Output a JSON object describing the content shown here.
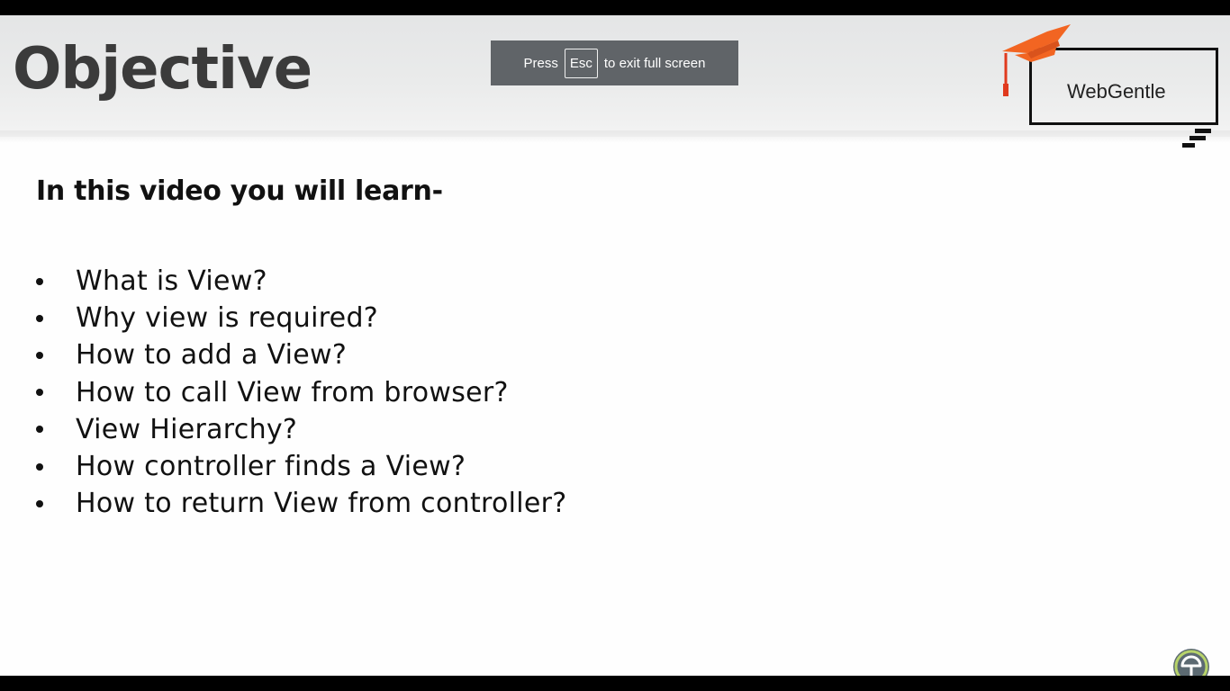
{
  "slide": {
    "title": "Objective",
    "subtitle": "In this video you will learn-",
    "bullets": [
      "What is View?",
      "Why view is required?",
      "How to add a View?",
      "How to call View from browser?",
      "View Hierarchy?",
      "How controller finds a View?",
      "How to return View from controller?"
    ]
  },
  "logo": {
    "text": "WebGentle",
    "icon": "graduation-cap-icon"
  },
  "fullscreen_notice": {
    "prefix": "Press",
    "key": "Esc",
    "suffix": "to exit full screen"
  },
  "corner_badge": {
    "icon": "player-logo-icon"
  },
  "colors": {
    "cap_orange": "#f26522",
    "title_gray": "#3b3b3b",
    "toast_bg": "#606468"
  }
}
